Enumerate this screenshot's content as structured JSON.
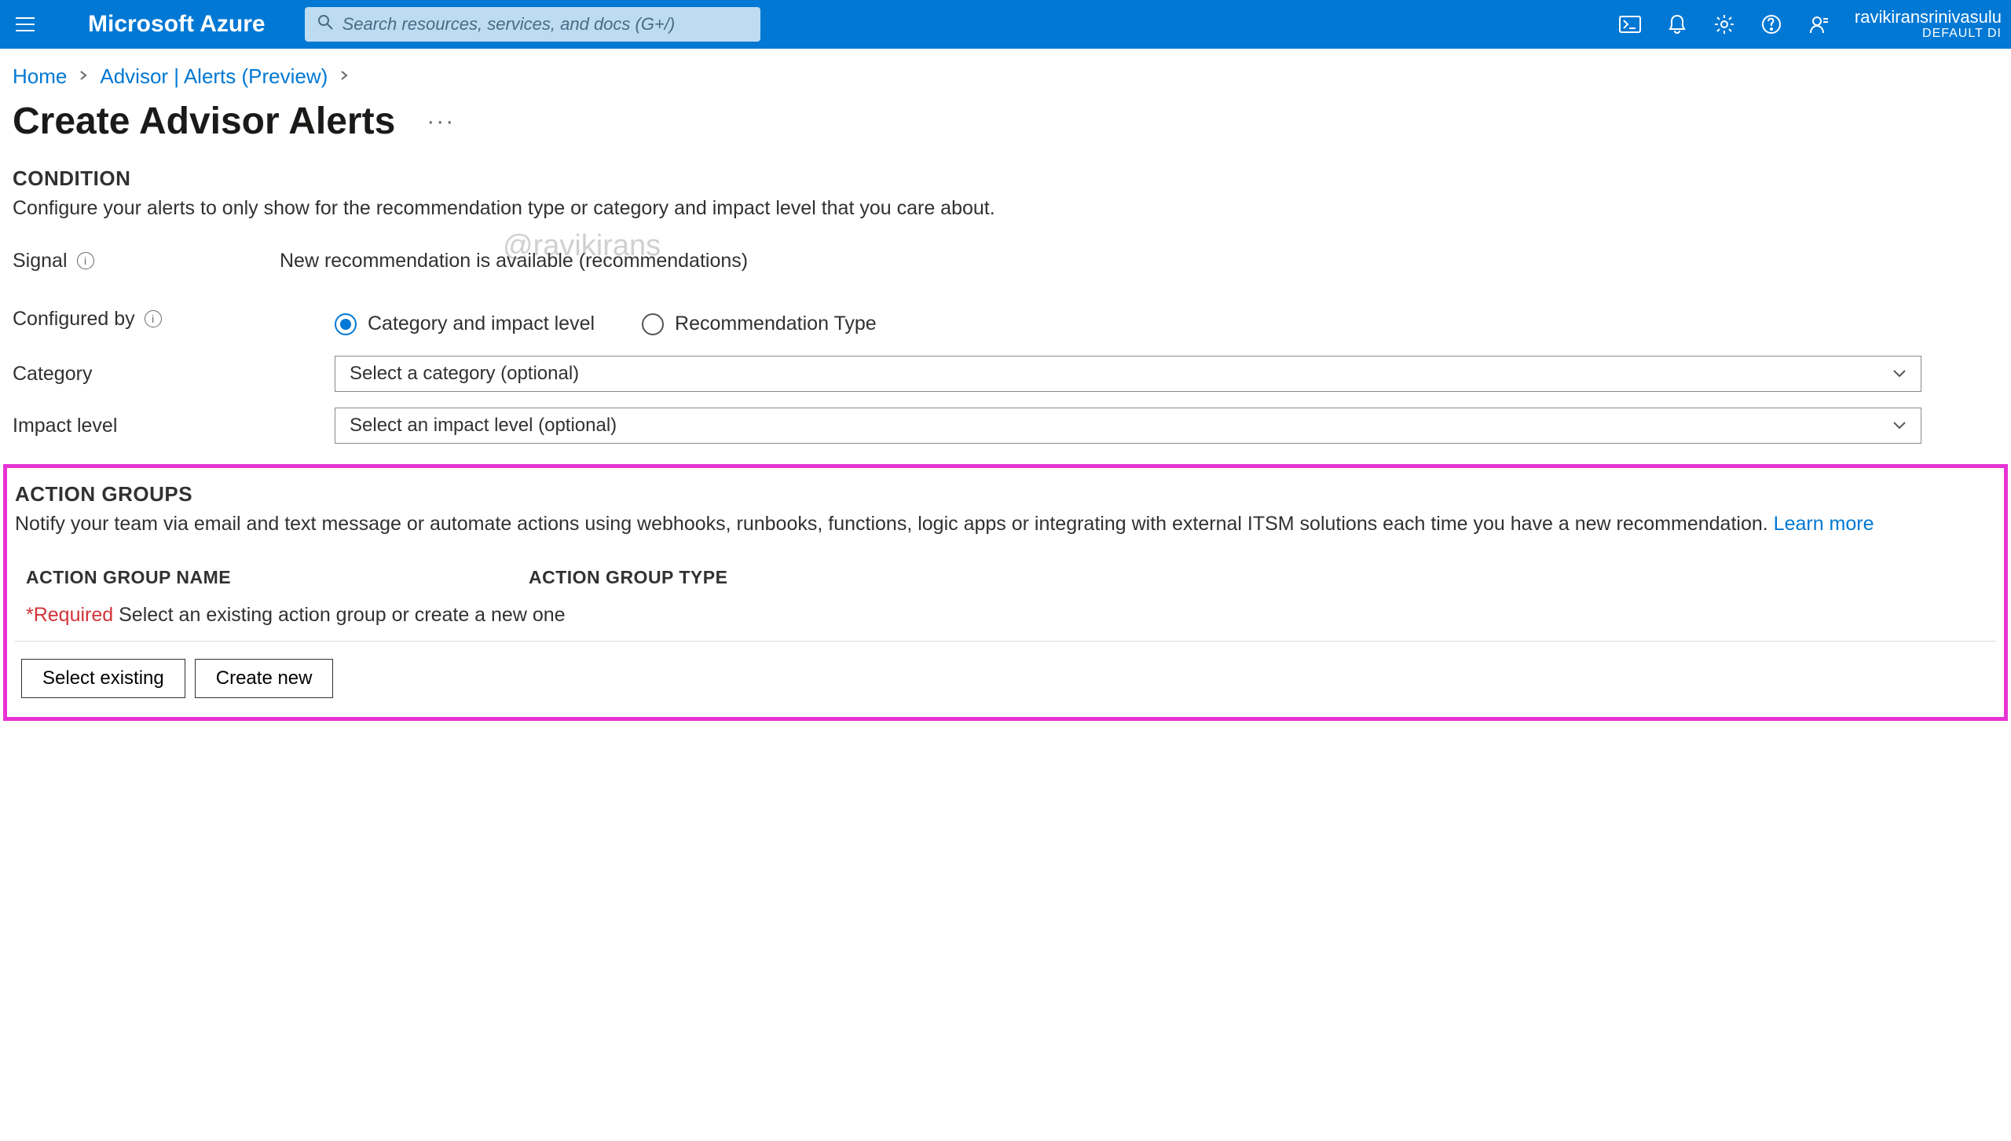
{
  "header": {
    "brand": "Microsoft Azure",
    "search_placeholder": "Search resources, services, and docs (G+/)",
    "account_name": "ravikiransrinivasulu",
    "account_dir": "DEFAULT DI"
  },
  "breadcrumb": {
    "home": "Home",
    "advisor": "Advisor | Alerts (Preview)"
  },
  "page": {
    "title": "Create Advisor Alerts"
  },
  "condition": {
    "title": "CONDITION",
    "desc": "Configure your alerts to only show for the recommendation type or category and impact level that you care about.",
    "signal_label": "Signal",
    "signal_value": "New recommendation is available (recommendations)",
    "configured_by_label": "Configured by",
    "radio_category": "Category and impact level",
    "radio_rectype": "Recommendation Type",
    "category_label": "Category",
    "category_placeholder": "Select a category (optional)",
    "impact_label": "Impact level",
    "impact_placeholder": "Select an impact level (optional)"
  },
  "actiongroups": {
    "title": "ACTION GROUPS",
    "desc": "Notify your team via email and text message or automate actions using webhooks, runbooks, functions, logic apps or integrating with external ITSM solutions each time you have a new recommendation. ",
    "learn_more": "Learn more",
    "col_name": "ACTION GROUP NAME",
    "col_type": "ACTION GROUP TYPE",
    "required_prefix": "*Required",
    "required_text": " Select an existing action group or create a new one",
    "btn_select": "Select existing",
    "btn_create": "Create new"
  },
  "watermark": "@ravikirans"
}
